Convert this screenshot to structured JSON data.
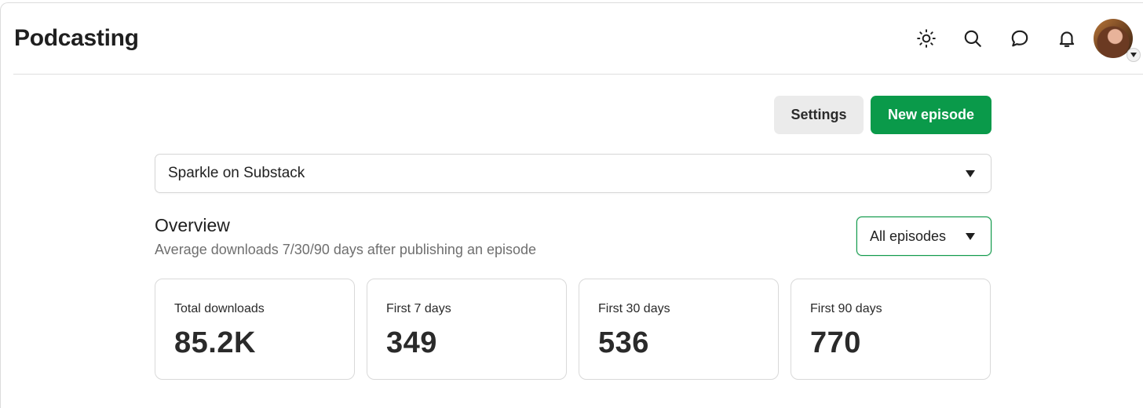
{
  "header": {
    "title": "Podcasting",
    "icons": [
      "sun-icon",
      "search-icon",
      "chat-bubble-icon",
      "bell-icon"
    ]
  },
  "toolbar": {
    "settings_label": "Settings",
    "new_episode_label": "New episode",
    "accent_color": "#0a9a4a"
  },
  "publication_select": {
    "value": "Sparkle on Substack"
  },
  "overview": {
    "title": "Overview",
    "subtitle": "Average downloads 7/30/90 days after publishing an episode",
    "filter_value": "All episodes",
    "cards": [
      {
        "label": "Total downloads",
        "value": "85.2K"
      },
      {
        "label": "First 7 days",
        "value": "349"
      },
      {
        "label": "First 30 days",
        "value": "536"
      },
      {
        "label": "First 90 days",
        "value": "770"
      }
    ]
  }
}
